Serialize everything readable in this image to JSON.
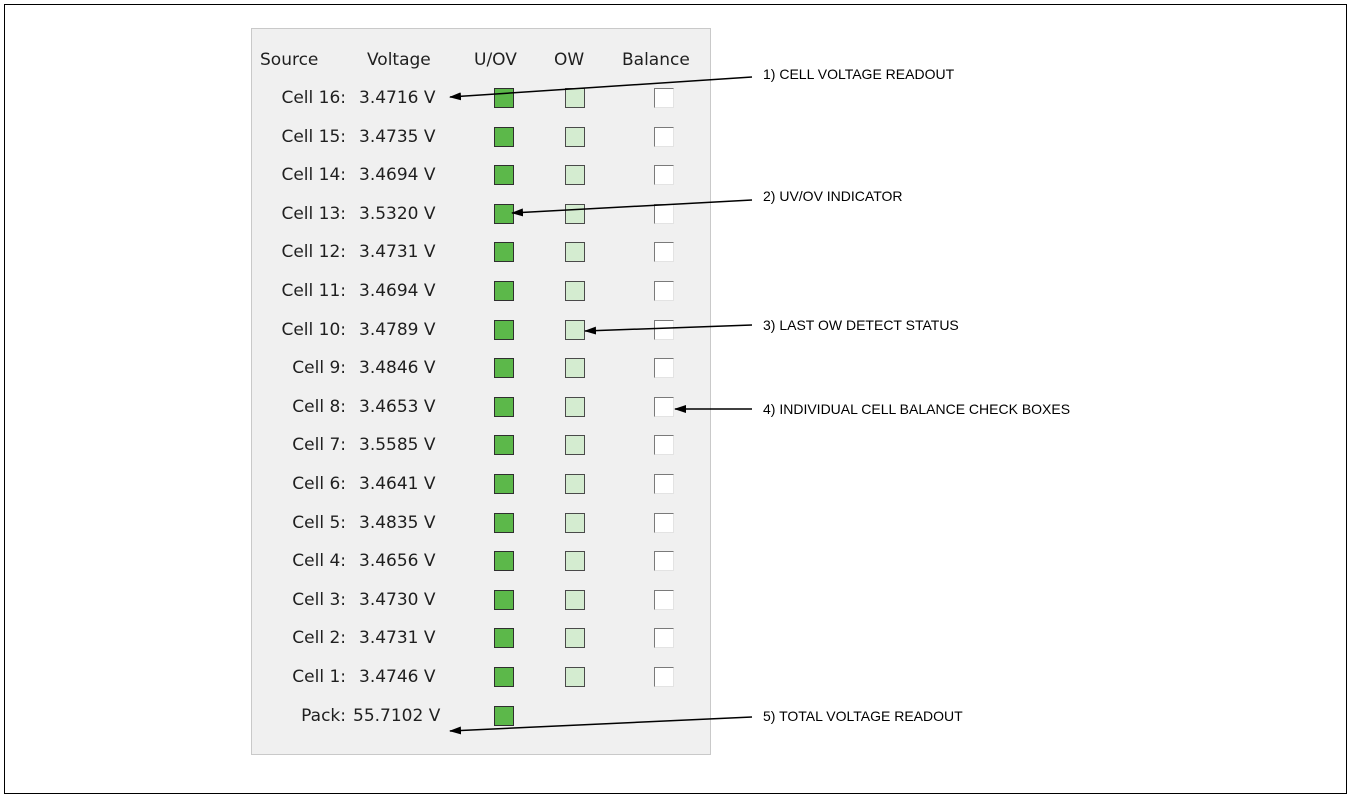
{
  "headers": {
    "source": "Source",
    "voltage": "Voltage",
    "uov": "U/OV",
    "ow": "OW",
    "balance": "Balance"
  },
  "rows": [
    {
      "source": "Cell 16:",
      "voltage": "3.4716 V"
    },
    {
      "source": "Cell 15:",
      "voltage": "3.4735 V"
    },
    {
      "source": "Cell 14:",
      "voltage": "3.4694 V"
    },
    {
      "source": "Cell 13:",
      "voltage": "3.5320 V"
    },
    {
      "source": "Cell 12:",
      "voltage": "3.4731 V"
    },
    {
      "source": "Cell 11:",
      "voltage": "3.4694 V"
    },
    {
      "source": "Cell 10:",
      "voltage": "3.4789 V"
    },
    {
      "source": "Cell 9:",
      "voltage": "3.4846 V"
    },
    {
      "source": "Cell 8:",
      "voltage": "3.4653 V"
    },
    {
      "source": "Cell 7:",
      "voltage": "3.5585 V"
    },
    {
      "source": "Cell 6:",
      "voltage": "3.4641 V"
    },
    {
      "source": "Cell 5:",
      "voltage": "3.4835 V"
    },
    {
      "source": "Cell 4:",
      "voltage": "3.4656 V"
    },
    {
      "source": "Cell 3:",
      "voltage": "3.4730 V"
    },
    {
      "source": "Cell 2:",
      "voltage": "3.4731 V"
    },
    {
      "source": "Cell 1:",
      "voltage": "3.4746 V"
    }
  ],
  "pack": {
    "source": "Pack:",
    "voltage": "55.7102 V"
  },
  "callouts": [
    "1) CELL VOLTAGE READOUT",
    "2) UV/OV INDICATOR",
    "3) LAST OW DETECT STATUS",
    "4) INDIVIDUAL CELL BALANCE CHECK BOXES",
    "5) TOTAL VOLTAGE READOUT"
  ],
  "colors": {
    "uov_ok": "#5cb84a",
    "ow_ok": "#d4ecd0",
    "panel_bg": "#f0f0f0"
  }
}
